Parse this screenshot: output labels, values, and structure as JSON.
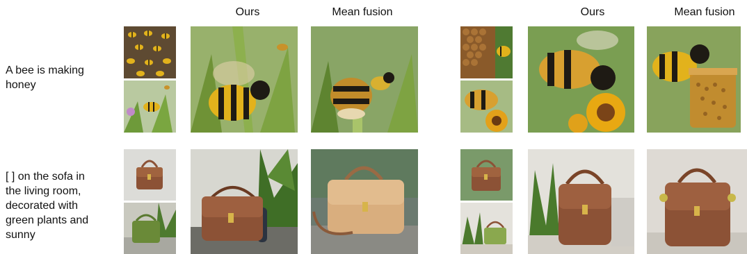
{
  "headers": {
    "left_ours": "Ours",
    "left_mean": "Mean fusion",
    "right_ours": "Ours",
    "right_mean": "Mean fusion"
  },
  "prompts": {
    "row1": [
      "A bee is making",
      "honey"
    ],
    "row2": [
      "[ ] on the sofa in",
      "the living room,",
      "decorated with",
      "green plants and",
      "sunny"
    ]
  },
  "colors": {
    "bee_yellow": "#e2b21c",
    "bee_black": "#1e1a14",
    "leaf_green": "#7a9a3a",
    "bag_brown": "#8c5236",
    "bag_tan": "#d9ae7e",
    "plant_green": "#4d7a2e"
  }
}
